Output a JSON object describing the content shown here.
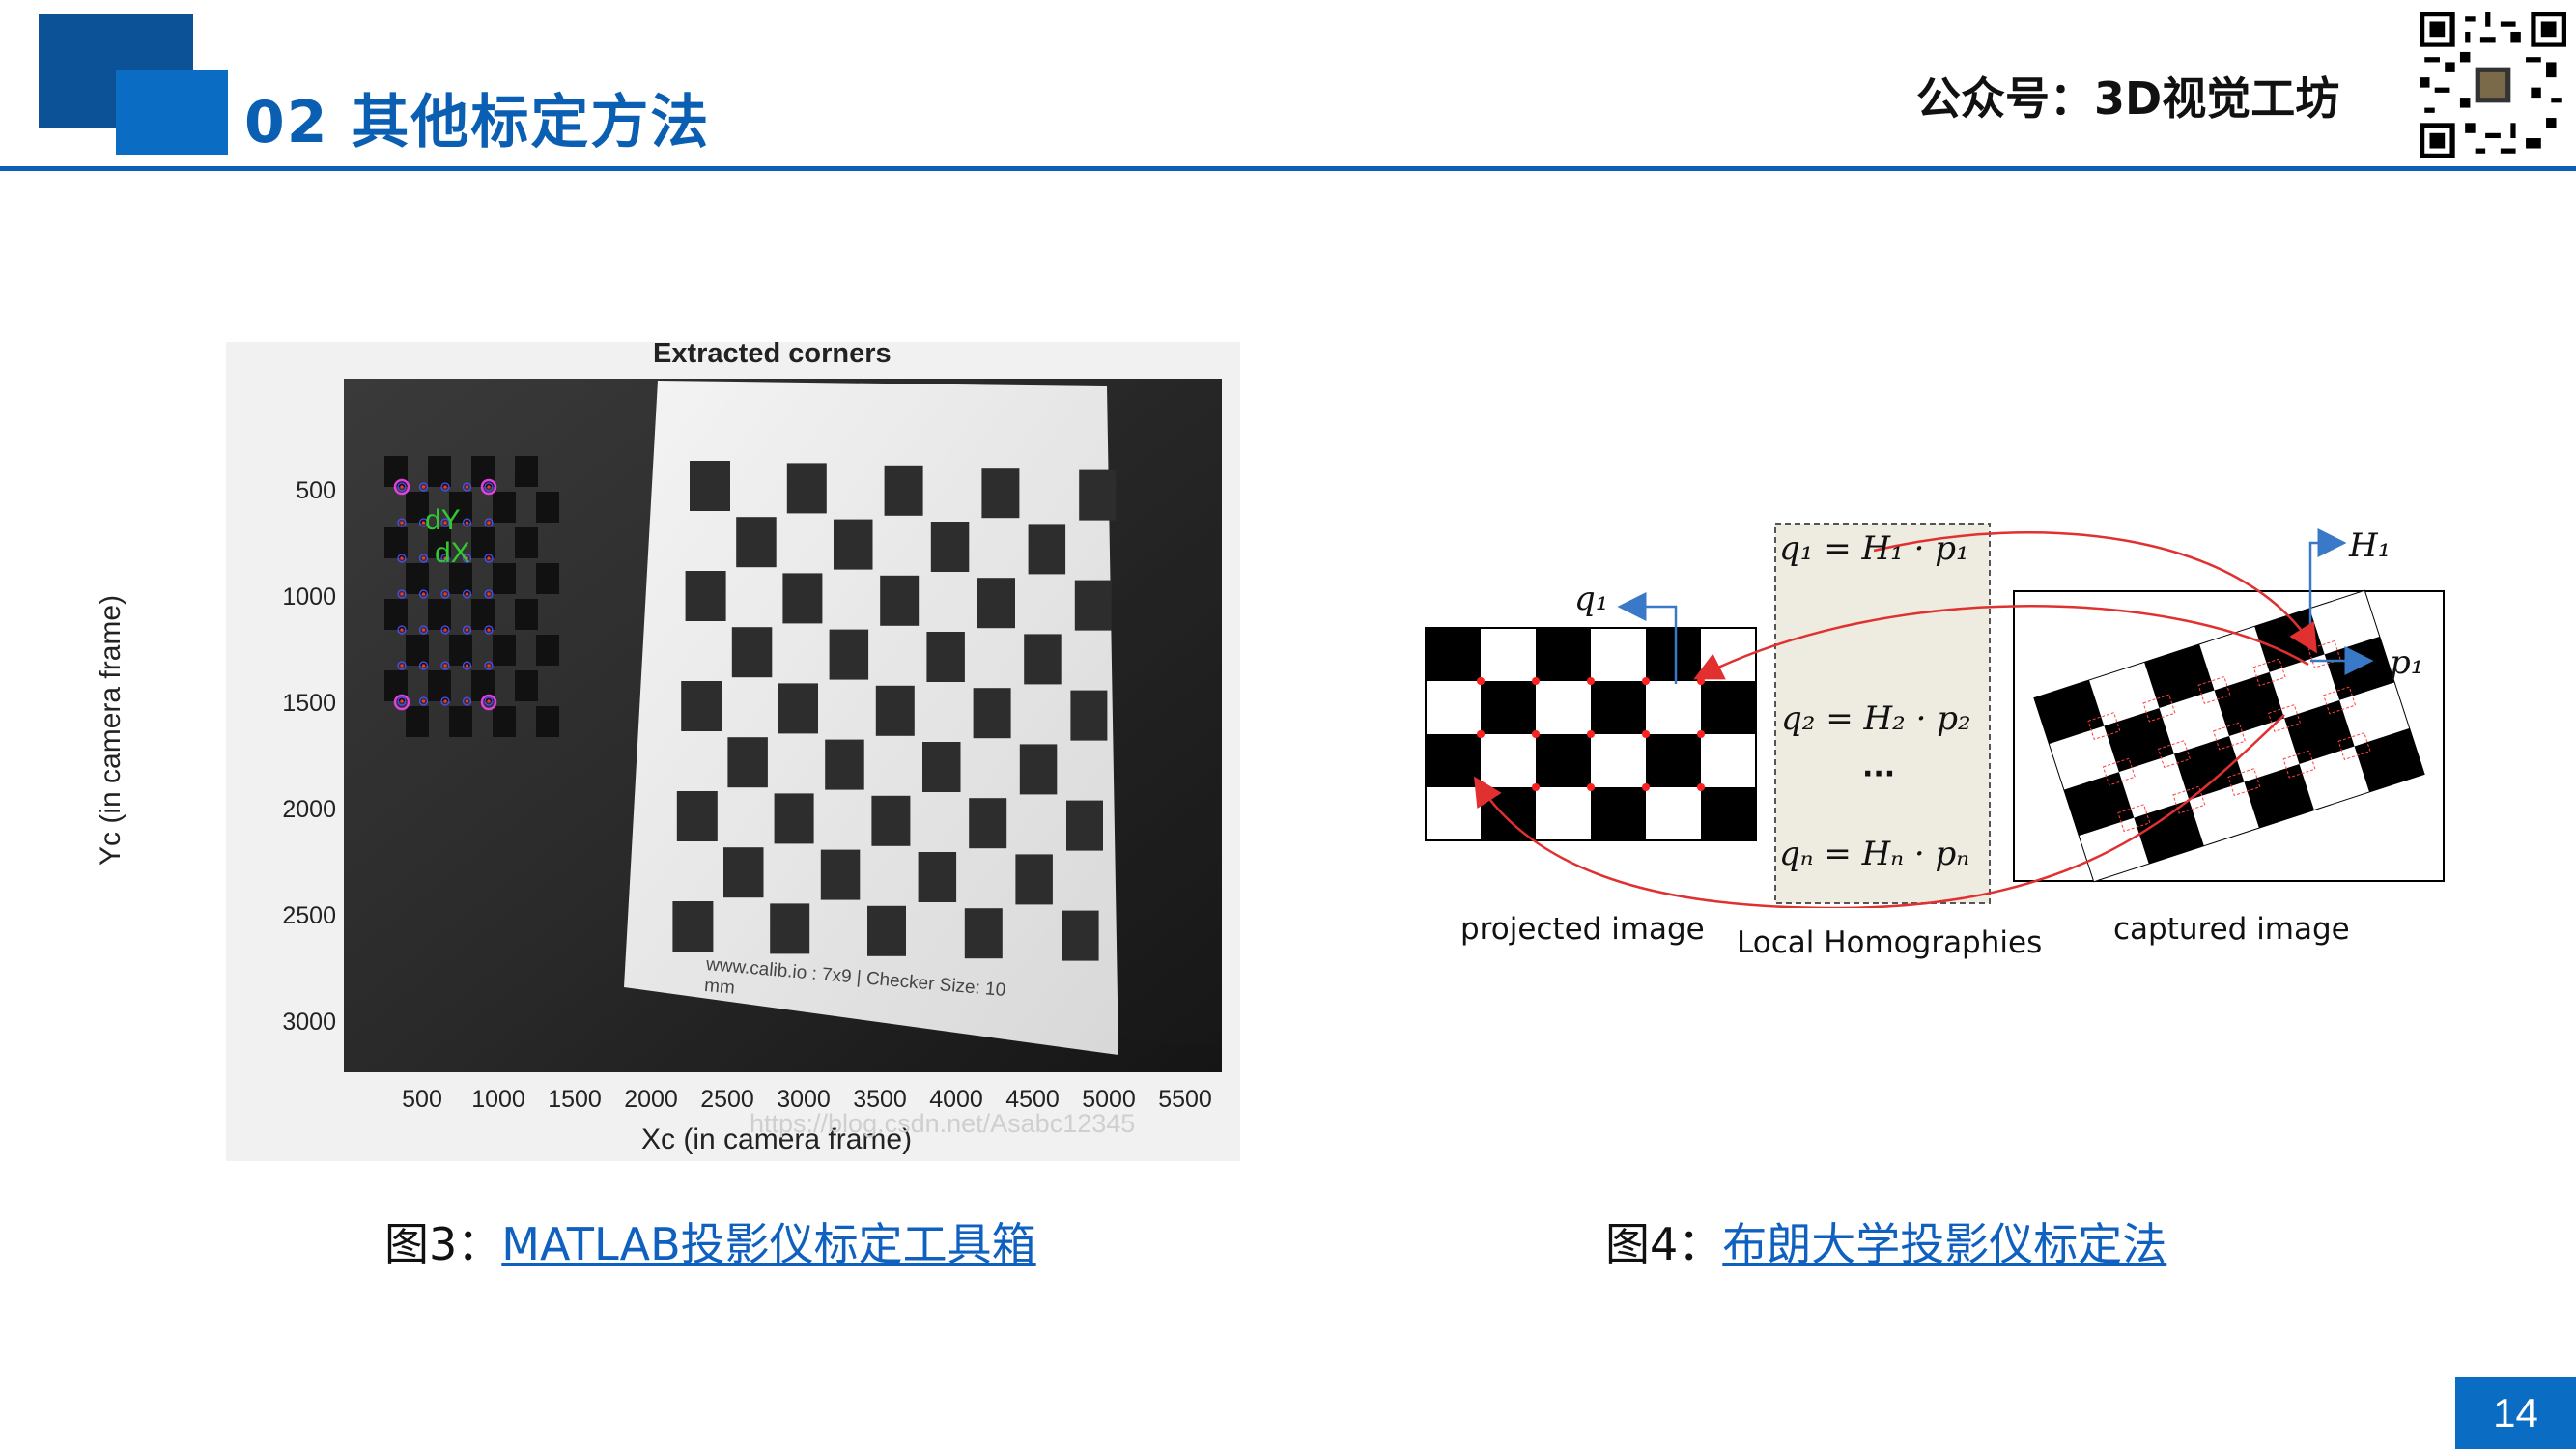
{
  "header": {
    "section_title": "02 其他标定方法",
    "brand": "公众号：3D视觉工坊"
  },
  "figure3": {
    "title": "Extracted corners",
    "ylabel": "Yc (in camera frame)",
    "xlabel": "Xc (in camera frame)",
    "yticks": [
      "500",
      "1000",
      "1500",
      "2000",
      "2500",
      "3000"
    ],
    "xticks": [
      "500",
      "1000",
      "1500",
      "2000",
      "2500",
      "3000",
      "3500",
      "4000",
      "4500",
      "5000",
      "5500"
    ],
    "marker_dy": "dY",
    "marker_dx": "dX",
    "board_text": "www.calib.io : 7x9 | Checker Size: 10 mm",
    "watermark": "https://blog.csdn.net/Asabc12345"
  },
  "figure4": {
    "eq1": "q₁ = H₁ · p₁",
    "eq2": "q₂ = H₂ · p₂",
    "dots": "···",
    "eqn": "qₙ = Hₙ · pₙ",
    "q1": "q₁",
    "H1": "H₁",
    "p1": "p₁",
    "projected_label": "projected image",
    "local_label": "Local Homographies",
    "captured_label": "captured image"
  },
  "captions": {
    "fig3_prefix": "图3：",
    "fig3_link": "MATLAB投影仪标定工具箱",
    "fig4_prefix": "图4：",
    "fig4_link": "布朗大学投影仪标定法"
  },
  "page_number": "14",
  "colors": {
    "primary_blue": "#0b5fb3",
    "dark_blue": "#0b5396",
    "link_blue": "#1060c0",
    "arrow_red": "#e03030"
  }
}
